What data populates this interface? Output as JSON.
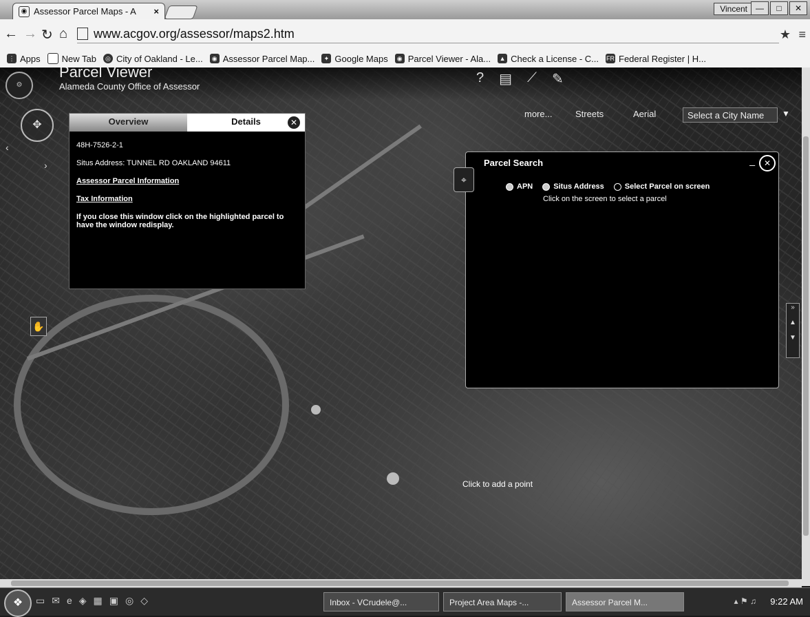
{
  "browser": {
    "tab_title": "Assessor Parcel Maps - A",
    "tab_close": "×",
    "user": "Vincent",
    "url": "www.acgov.org/assessor/maps2.htm",
    "bookmarks": [
      {
        "label": "Apps",
        "icon": "apps-grid-icon"
      },
      {
        "label": "New Tab",
        "icon": "page-icon"
      },
      {
        "label": "City of Oakland - Le...",
        "icon": "city-seal-icon"
      },
      {
        "label": "Assessor Parcel Map...",
        "icon": "assessor-icon"
      },
      {
        "label": "Google Maps",
        "icon": "map-pin-icon"
      },
      {
        "label": "Parcel Viewer - Ala...",
        "icon": "assessor-icon"
      },
      {
        "label": "Check a License - C...",
        "icon": "license-icon"
      },
      {
        "label": "Federal Register | H...",
        "icon": "federal-register-icon"
      }
    ]
  },
  "app": {
    "title": "Parcel Viewer",
    "subtitle": "Alameda County Office of Assessor"
  },
  "map_controls": {
    "more": "more...",
    "streets": "Streets",
    "aerial": "Aerial",
    "city_select": "Select a City Name"
  },
  "details": {
    "tab_overview": "Overview",
    "tab_details": "Details",
    "apn": "48H-7526-2-1",
    "situs": "Situs Address: TUNNEL RD OAKLAND 94611",
    "link_parcel": "Assessor Parcel Information",
    "link_tax": "Tax Information",
    "note": "If you close this window click on the highlighted parcel to have the window redisplay."
  },
  "parcel_search": {
    "title": "Parcel Search",
    "opt_apn": "APN",
    "opt_situs": "Situs Address",
    "opt_select": "Select Parcel on screen",
    "hint": "Click on the screen to select a parcel"
  },
  "tooltip": "Click to add a point",
  "taskbar": {
    "tasks": [
      "Inbox - VCrudele@...",
      "Project Area Maps -...",
      "Assessor Parcel M..."
    ],
    "time": "9:22 AM"
  }
}
